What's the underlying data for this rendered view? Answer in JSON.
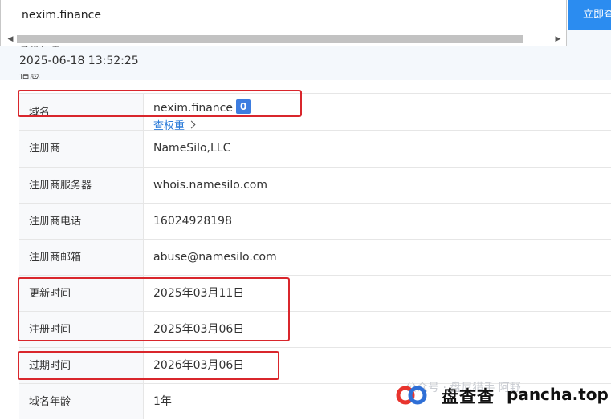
{
  "search": {
    "value": "nexim.finance",
    "button_label": "立即查询"
  },
  "header": {
    "query_time_label": "查询信息",
    "query_time": "2025-06-18 13:52:25",
    "info_label": "信息"
  },
  "whois": {
    "domain": {
      "label": "域名",
      "value": "nexim.finance",
      "badge": "0",
      "link": "查权重"
    },
    "rows": [
      {
        "label": "注册商",
        "value": "NameSilo,LLC"
      },
      {
        "label": "注册商服务器",
        "value": "whois.namesilo.com"
      },
      {
        "label": "注册商电话",
        "value": "16024928198"
      },
      {
        "label": "注册商邮箱",
        "value": "abuse@namesilo.com"
      },
      {
        "label": "更新时间",
        "value": "2025年03月11日"
      },
      {
        "label": "注册时间",
        "value": "2025年03月06日"
      },
      {
        "label": "过期时间",
        "value": "2026年03月06日"
      },
      {
        "label": "域名年龄",
        "value": "1年"
      }
    ]
  },
  "watermark": {
    "faint_text": "公众号 · 盘尼猎手 阿野",
    "brand": "盘查查",
    "site": "pancha.top"
  },
  "colors": {
    "accent": "#2b8cf0",
    "annotation": "#d9262c",
    "badge": "#3d7de0",
    "link": "#2b7bd8"
  }
}
